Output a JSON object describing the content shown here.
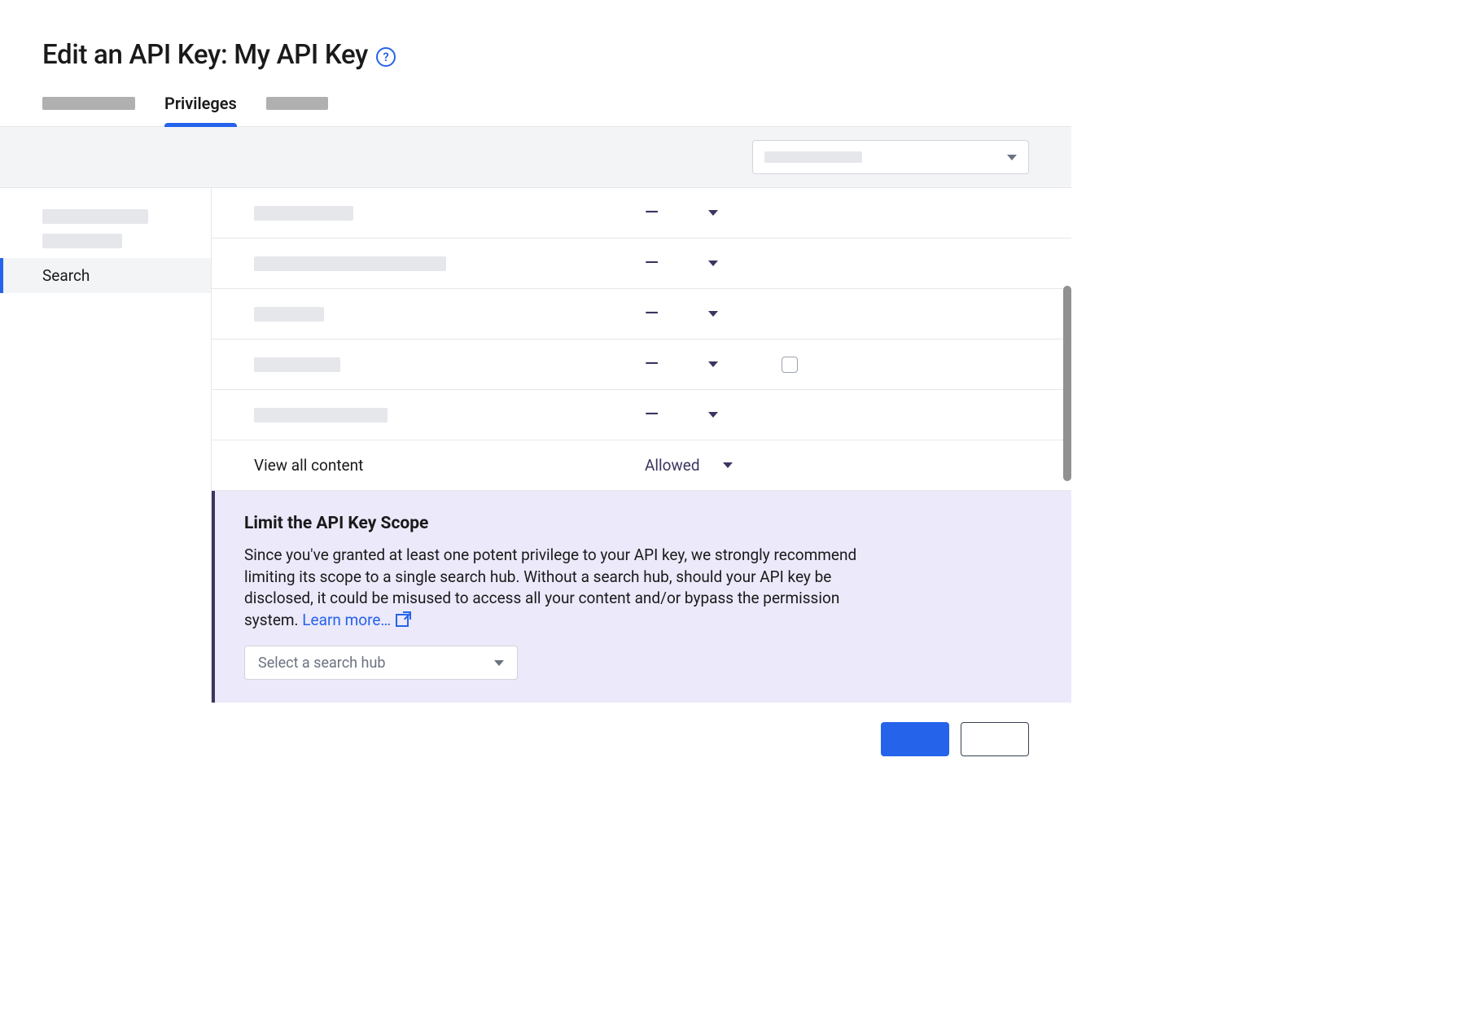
{
  "page_title": "Edit an API Key: My API Key",
  "help_glyph": "?",
  "tabs": {
    "active_label": "Privileges"
  },
  "sidebar": {
    "active_label": "Search"
  },
  "privileges": {
    "rows": [
      {
        "value": "—",
        "label_width": "122px"
      },
      {
        "value": "—",
        "label_width": "236px"
      },
      {
        "value": "—",
        "label_width": "86px"
      },
      {
        "value": "—",
        "label_width": "106px",
        "has_checkbox": true
      },
      {
        "value": "—",
        "label_width": "164px"
      }
    ],
    "named_row": {
      "label": "View all content",
      "value": "Allowed"
    }
  },
  "info": {
    "title": "Limit the API Key Scope",
    "body": "Since you've granted at least one potent privilege to your API key, we strongly recommend limiting its scope to a single search hub. Without a search hub, should your API key be disclosed, it could be misused to access all your content and/or bypass the permission system.",
    "learn_more": "Learn more…",
    "hub_placeholder": "Select a search hub"
  }
}
